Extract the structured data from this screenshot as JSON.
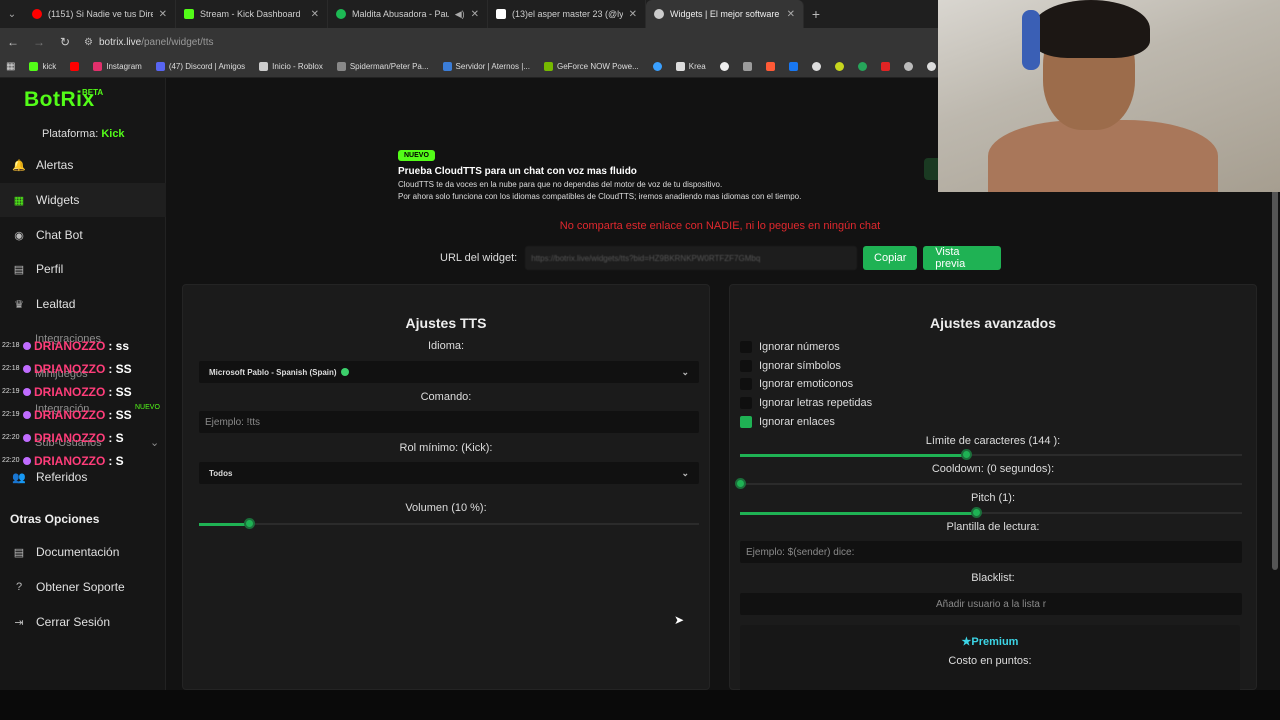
{
  "browser": {
    "tabs": [
      {
        "label": "(1151) Si Nadie ve tus Directos",
        "color": "#ff0000",
        "active": false
      },
      {
        "label": "Stream - Kick Dashboard",
        "color": "#53fc18",
        "active": false
      },
      {
        "label": "Maldita Abusadora - Paulo",
        "color": "#1db954",
        "active": false
      },
      {
        "label": "(13)el asper master 23 (@lyrics...",
        "color": "#ffffff",
        "active": false
      },
      {
        "label": "Widgets | El mejor software par",
        "color": "#cccccc",
        "active": true
      }
    ],
    "url_host": "botrix.live",
    "url_path": "/panel/widget/tts",
    "bookmarks": [
      {
        "label": "kick",
        "color": "#53fc18"
      },
      {
        "label": "",
        "color": "#ff0000"
      },
      {
        "label": "Instagram",
        "color": "#e1306c"
      },
      {
        "label": "(47) Discord | Amigos",
        "color": "#5865f2"
      },
      {
        "label": "Inicio - Roblox",
        "color": "#cccccc"
      },
      {
        "label": "Spiderman/Peter Pa...",
        "color": "#888888"
      },
      {
        "label": "Servidor | Aternos |...",
        "color": "#3b7dd8"
      },
      {
        "label": "GeForce NOW Powe...",
        "color": "#76b900"
      },
      {
        "label": "",
        "color": "#3aa0ff"
      },
      {
        "label": "Krea",
        "color": "#dddddd"
      }
    ]
  },
  "brand": {
    "name": "BotRix",
    "badge": "BETA"
  },
  "sidebar": {
    "platform_label": "Plataforma:",
    "platform_value": "Kick",
    "items": [
      {
        "label": "Alertas",
        "icon": "bell-icon",
        "glyph": "🔔"
      },
      {
        "label": "Widgets",
        "icon": "grid-icon",
        "glyph": "▦"
      },
      {
        "label": "Chat Bot",
        "icon": "robot-icon",
        "glyph": "◉"
      },
      {
        "label": "Perfil",
        "icon": "profile-icon",
        "glyph": "▤"
      },
      {
        "label": "Lealtad",
        "icon": "trophy-icon",
        "glyph": "♛"
      },
      {
        "label": "Referidos",
        "icon": "users-icon",
        "glyph": "👥"
      }
    ],
    "section": "Otras Opciones",
    "other_items": [
      {
        "label": "Documentación",
        "icon": "document-icon",
        "glyph": "▤"
      },
      {
        "label": "Obtener Soporte",
        "icon": "help-icon",
        "glyph": "?"
      },
      {
        "label": "Cerrar Sesión",
        "icon": "logout-icon",
        "glyph": "⇥"
      }
    ],
    "ghost_items": [
      "Integraciones",
      "Minijuegos",
      "Integración",
      "Sub-Usuarios"
    ],
    "ghost_badge": "NUEVO"
  },
  "chat_overlay": [
    {
      "time": "22:18",
      "user": "DRIANOZZO",
      "msg": ": ss"
    },
    {
      "time": "22:18",
      "user": "DRIANOZZO",
      "msg": ": SS"
    },
    {
      "time": "22:19",
      "user": "DRIANOZZO",
      "msg": ": SS"
    },
    {
      "time": "22:19",
      "user": "DRIANOZZO",
      "msg": ": SS"
    },
    {
      "time": "22:20",
      "user": "DRIANOZZO",
      "msg": ": S"
    },
    {
      "time": "22:20",
      "user": "DRIANOZZO",
      "msg": ": S"
    }
  ],
  "banner": {
    "badge": "NUEVO",
    "title": "Prueba CloudTTS para un chat con voz mas fluido",
    "line1": "CloudTTS te da voces en la nube para que no dependas del motor de voz de tu dispositivo.",
    "line2": "Por ahora solo funciona con los idiomas compatibles de CloudTTS; iremos anadiendo mas idiomas con el tiempo."
  },
  "warning": "No comparta este enlace con NADIE, ni lo pegues en ningún chat",
  "widget_url": {
    "label": "URL del widget:",
    "value": "https://botrix.live/widgets/tts?bid=HZ9BKRNKPW0RTFZF7GMbq",
    "copy": "Copiar",
    "preview": "Vista previa"
  },
  "tts": {
    "title": "Ajustes TTS",
    "language_label": "Idioma:",
    "language_value": "Microsoft Pablo - Spanish (Spain)",
    "command_label": "Comando:",
    "command_placeholder": "Ejemplo: !tts",
    "role_label": "Rol mínimo: (Kick):",
    "role_value": "Todos",
    "volume_label": "Volumen (10 %):",
    "volume": 0.1
  },
  "advanced": {
    "title": "Ajustes avanzados",
    "checks": [
      {
        "label": "Ignorar números",
        "checked": false
      },
      {
        "label": "Ignorar símbolos",
        "checked": false
      },
      {
        "label": "Ignorar emoticonos",
        "checked": false
      },
      {
        "label": "Ignorar letras repetidas",
        "checked": false
      },
      {
        "label": "Ignorar enlaces",
        "checked": true
      }
    ],
    "char_limit_label": "Límite de caracteres (144 ):",
    "char_limit": 0.45,
    "cooldown_label": "Cooldown: (0 segundos):",
    "cooldown": 0,
    "pitch_label": "Pitch (1):",
    "pitch": 0.47,
    "template_label": "Plantilla de lectura:",
    "template_placeholder": "Ejemplo: $(sender) dice:",
    "blacklist_label": "Blacklist:",
    "blacklist_placeholder": "Añadir usuario a la lista r",
    "premium_title": "Premium",
    "points_label": "Costo en puntos:"
  },
  "colors": {
    "accent": "#53fc18",
    "button": "#1fb254",
    "warning": "#e0282e",
    "premium": "#3cd5e6"
  }
}
